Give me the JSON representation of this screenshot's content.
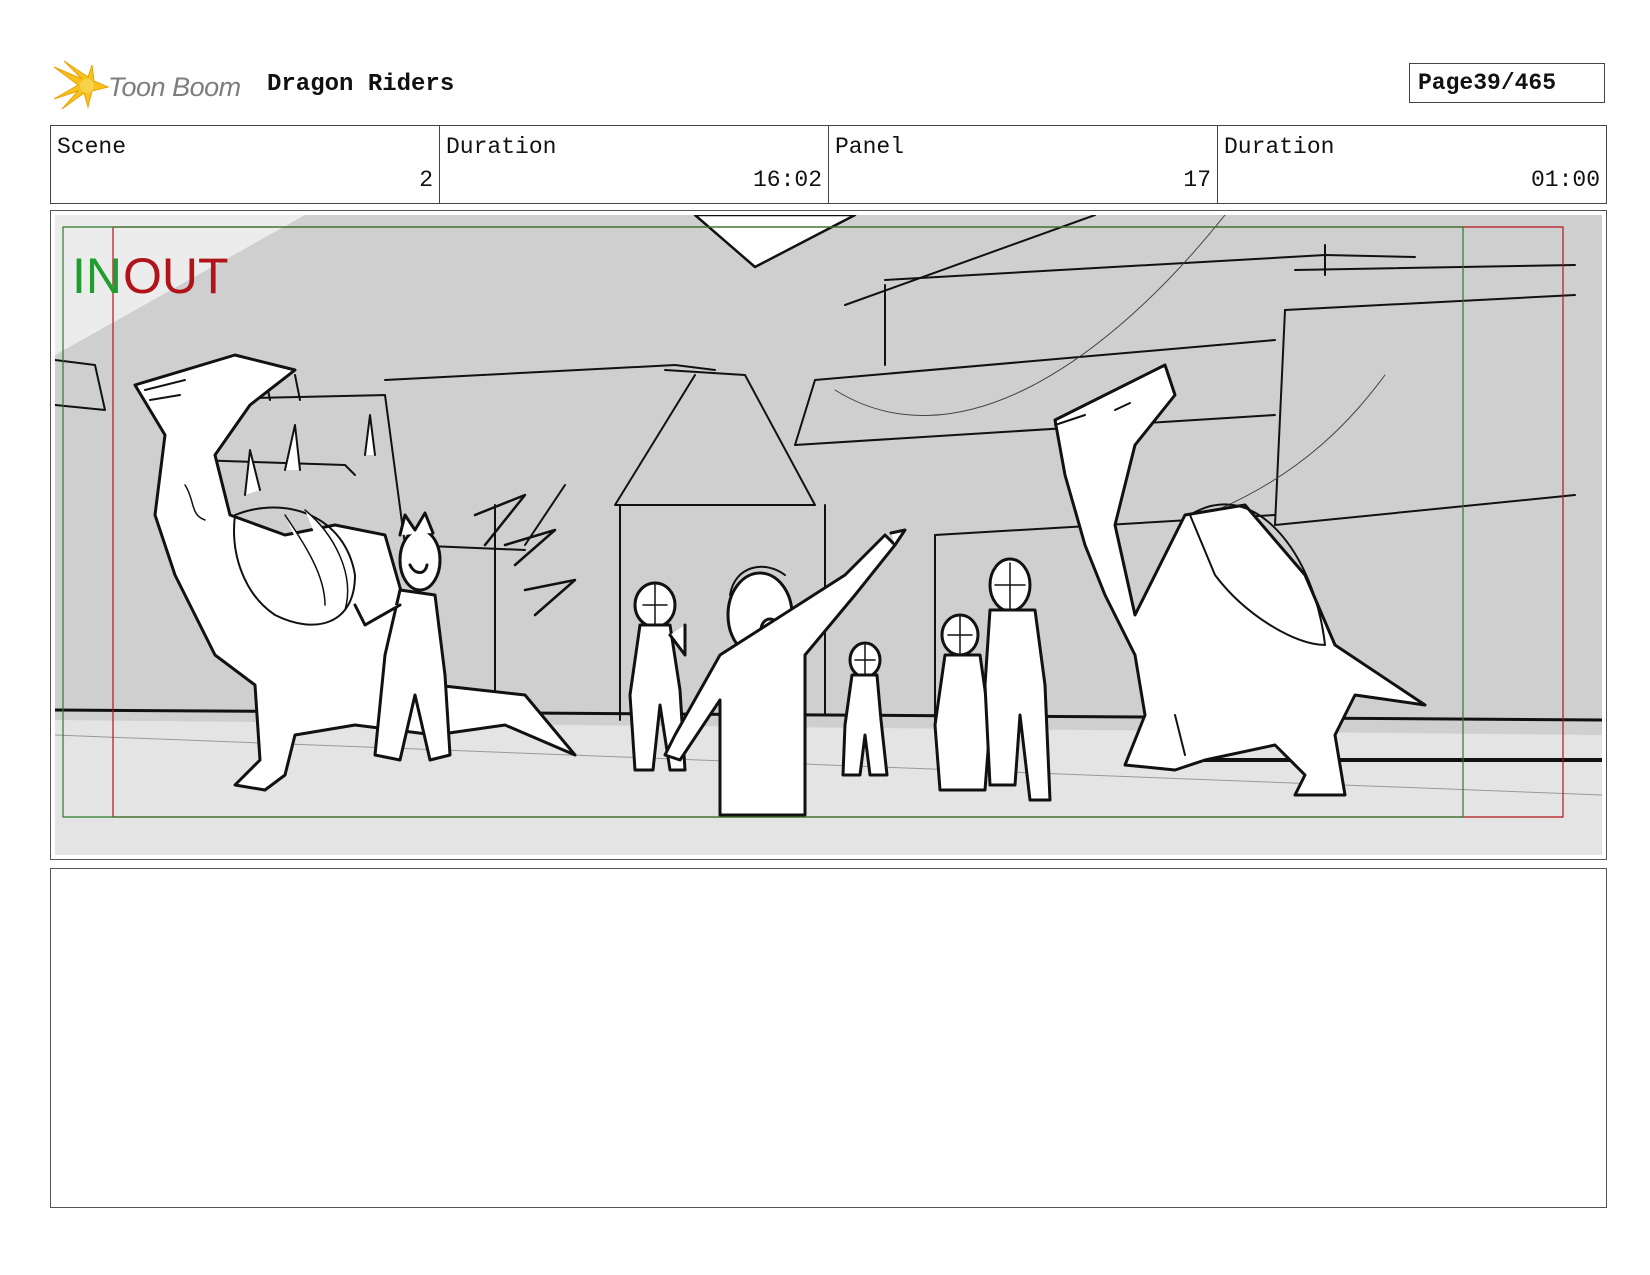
{
  "header": {
    "brand": "Toon Boom",
    "project_title": "Dragon Riders",
    "page_label": "Page",
    "page_number": "39/465"
  },
  "info": {
    "scene_label": "Scene",
    "scene_value": "2",
    "scene_duration_label": "Duration",
    "scene_duration_value": "16:02",
    "panel_label": "Panel",
    "panel_value": "17",
    "panel_duration_label": "Duration",
    "panel_duration_value": "01:00"
  },
  "panel": {
    "in_marker": "IN",
    "out_marker": "OUT"
  },
  "colors": {
    "in_marker": "#1e9e2e",
    "out_marker": "#b0141a",
    "logo_star": "#f6c21b",
    "sketch_bg": "#cfcfcf",
    "ground": "#e4e4e4"
  }
}
